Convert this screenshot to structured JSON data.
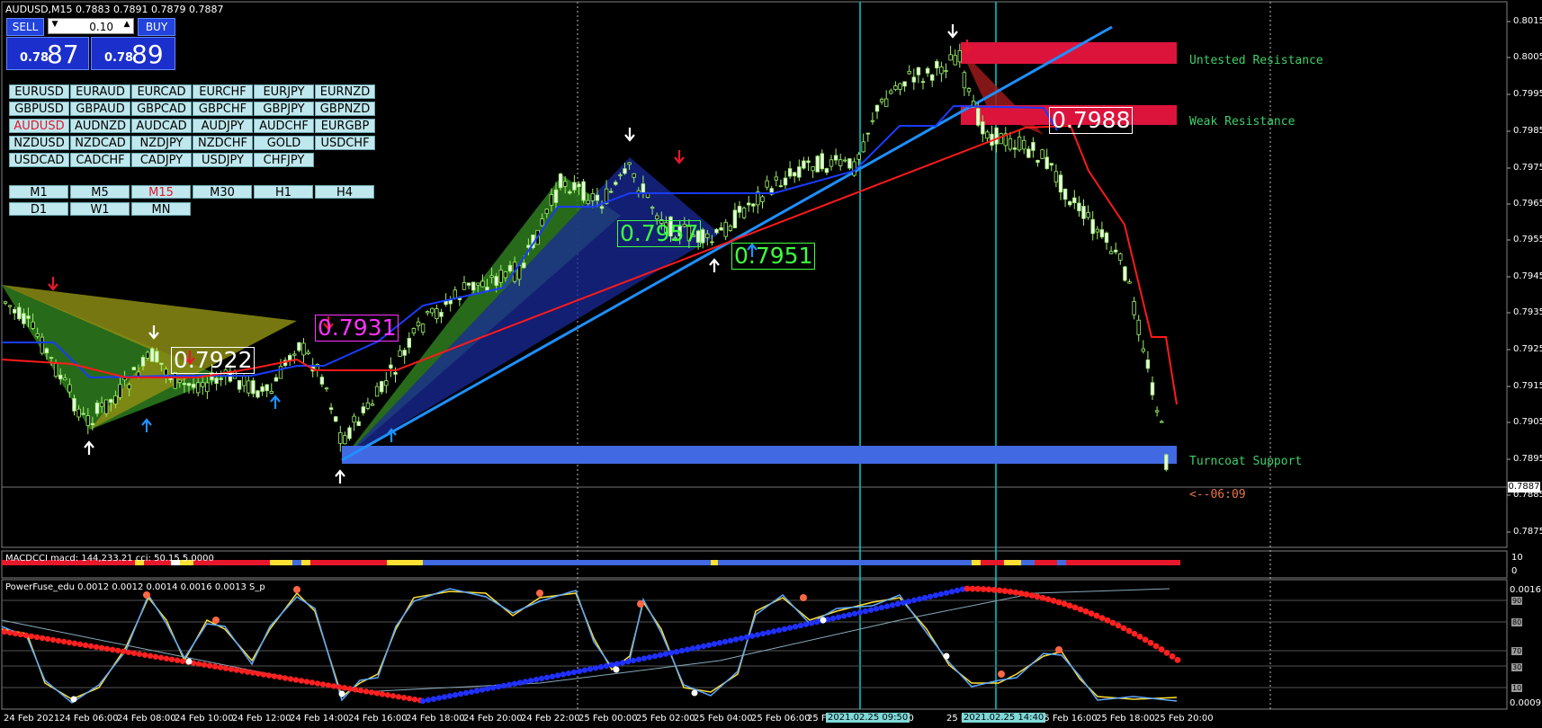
{
  "window": {
    "title": "AUDUSD,M15  0.7883 0.7891 0.7879 0.7887"
  },
  "trade_panel": {
    "sell_label": "SELL",
    "buy_label": "BUY",
    "lot_value": "0.10",
    "sell_price_small": "0.78",
    "sell_price_big": "87",
    "buy_price_small": "0.78",
    "buy_price_big": "89"
  },
  "symbols": [
    [
      "EURUSD",
      "EURAUD",
      "EURCAD",
      "EURCHF",
      "EURJPY",
      "EURNZD"
    ],
    [
      "GBPUSD",
      "GBPAUD",
      "GBPCAD",
      "GBPCHF",
      "GBPJPY",
      "GBPNZD"
    ],
    [
      "AUDUSD",
      "AUDNZD",
      "AUDCAD",
      "AUDJPY",
      "AUDCHF",
      "EURGBP"
    ],
    [
      "NZDUSD",
      "NZDCAD",
      "NZDJPY",
      "NZDCHF",
      "GOLD",
      "USDCHF"
    ],
    [
      "USDCAD",
      "CADCHF",
      "CADJPY",
      "USDJPY",
      "CHFJPY"
    ]
  ],
  "active_symbol": "AUDUSD",
  "timeframes": [
    [
      "M1",
      "M5",
      "M15",
      "M30",
      "H1",
      "H4"
    ],
    [
      "D1",
      "W1",
      "MN"
    ]
  ],
  "active_timeframe": "M15",
  "price_axis": [
    "0.8015",
    "0.8005",
    "0.7995",
    "0.7985",
    "0.7975",
    "0.7965",
    "0.7955",
    "0.7945",
    "0.7935",
    "0.7925",
    "0.7915",
    "0.7905",
    "0.7895",
    "0.7887",
    "0.7885",
    "0.7875"
  ],
  "current_price": "0.7887",
  "zones": {
    "untested_resistance": "Untested Resistance",
    "weak_resistance": "Weak Resistance",
    "turncoat_support": "Turncoat Support",
    "countdown": "<--06:09"
  },
  "price_labels": [
    "0.7931",
    "0.7922",
    "0.7957",
    "0.7951",
    "0.7988"
  ],
  "indicator1": {
    "title": "MACDCCI macd: 144,233.21 cci: 50.15 5.0000",
    "scale": [
      "10",
      "0"
    ]
  },
  "indicator2": {
    "title": "PowerFuse_edu 0.0012 0.0012 0.0014 0.0016 0.0013  S_p",
    "scale": [
      "0.0016",
      "90",
      "80",
      "70",
      "30",
      "10",
      "0.0009"
    ]
  },
  "time_axis": [
    "24 Feb 2021",
    "24 Feb 06:00",
    "24 Feb 08:00",
    "24 Feb 10:00",
    "24 Feb 12:00",
    "24 Feb 14:00",
    "24 Feb 16:00",
    "24 Feb 18:00",
    "24 Feb 20:00",
    "24 Feb 22:00",
    "25 Feb 00:00",
    "25 Feb 02:00",
    "25 Feb 04:00",
    "25 Feb 06:00",
    "25 F",
    "10:00",
    "25 Feb 12",
    "25 Feb 16:00",
    "25 Feb 18:00",
    "25 Feb 20:00"
  ],
  "time_markers": [
    "2021.02.25 09:50",
    "2021.02.25 14:40"
  ],
  "colors": {
    "bull_candle": "#9cf06a",
    "red_zone": "#dc143c",
    "blue_zone": "#4169e1",
    "trendline": "#1e90ff",
    "cursor_line": "#00ced1",
    "zone_text": "#3fcf6a"
  }
}
